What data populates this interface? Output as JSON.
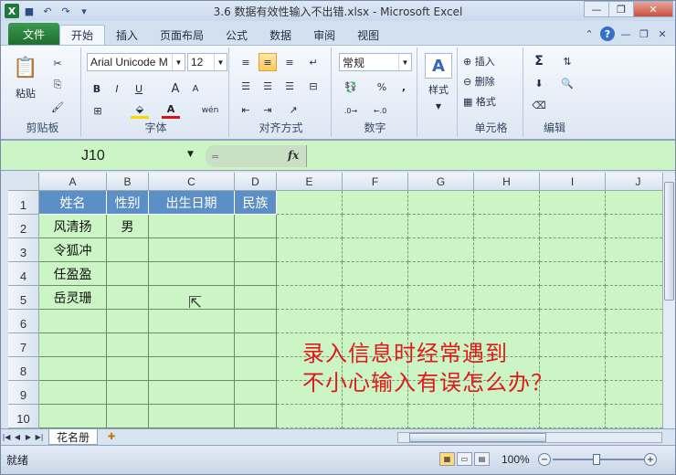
{
  "window": {
    "title": "3.6 数据有效性输入不出错.xlsx - Microsoft Excel",
    "app_icon": "excel-icon"
  },
  "quick_access": [
    {
      "icon": "save-icon",
      "glyph": "💾"
    },
    {
      "icon": "undo-icon",
      "glyph": "↶"
    },
    {
      "icon": "redo-icon",
      "glyph": "↷"
    },
    {
      "icon": "customize-icon",
      "glyph": "▾"
    }
  ],
  "tabs": {
    "file": "文件",
    "items": [
      "开始",
      "插入",
      "页面布局",
      "公式",
      "数据",
      "审阅",
      "视图"
    ],
    "active": 0
  },
  "ribbon": {
    "clipboard": {
      "label": "剪贴板",
      "paste": "粘贴"
    },
    "font": {
      "label": "字体",
      "name": "Arial Unicode M",
      "size": "12",
      "bold": "B",
      "italic": "I",
      "underline": "U",
      "grow": "A",
      "shrink": "A",
      "wen": "wén"
    },
    "alignment": {
      "label": "对齐方式"
    },
    "number": {
      "label": "数字",
      "format": "常规",
      "percent": "%",
      "comma": ","
    },
    "styles": {
      "label": "样式"
    },
    "cells": {
      "label": "单元格",
      "insert": "插入",
      "delete": "删除",
      "format": "格式"
    },
    "editing": {
      "label": "编辑"
    }
  },
  "formula_bar": {
    "name_box": "J10",
    "fx": "fx",
    "value": ""
  },
  "columns": [
    "A",
    "B",
    "C",
    "D",
    "E",
    "F",
    "G",
    "H",
    "I",
    "J"
  ],
  "rows": [
    "1",
    "2",
    "3",
    "4",
    "5",
    "6",
    "7",
    "8",
    "9",
    "10"
  ],
  "table": {
    "headers": [
      "姓名",
      "性别",
      "出生日期",
      "民族"
    ],
    "data": [
      [
        "风清扬",
        "男",
        "",
        ""
      ],
      [
        "令狐冲",
        "",
        "",
        ""
      ],
      [
        "任盈盈",
        "",
        "",
        ""
      ],
      [
        "岳灵珊",
        "",
        "",
        ""
      ]
    ]
  },
  "overlay_text": {
    "line1": "录入信息时经常遇到",
    "line2": "不小心输入有误怎么办？"
  },
  "sheets": {
    "tabs": [
      "花名册"
    ]
  },
  "status": {
    "ready": "就绪",
    "zoom": "100%"
  },
  "colors": {
    "sheet_bg": "#ccf5c5",
    "header_fill": "#5d8fc7",
    "overlay_text": "#e1191a",
    "file_tab": "#2a7f3c"
  }
}
